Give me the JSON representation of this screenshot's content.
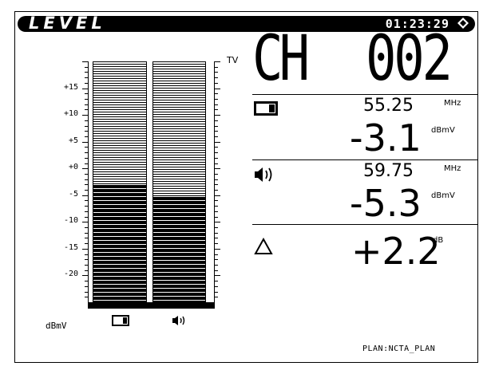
{
  "header": {
    "title": "LEVEL",
    "clock": "01:23:29"
  },
  "meter": {
    "y_labels": [
      "+15",
      "+10",
      "+5",
      "+0",
      "-5",
      "-10",
      "-15",
      "-20"
    ],
    "unit": "dBmV",
    "scale_min": -25,
    "scale_max": 20,
    "video_level": -3.1,
    "audio_level": -5.3
  },
  "channel": {
    "tv_label": "TV",
    "prefix": "CH",
    "number": "002"
  },
  "video": {
    "frequency": "55.25",
    "freq_unit": "MHz",
    "level": "-3.1",
    "level_unit": "dBmV"
  },
  "audio": {
    "frequency": "59.75",
    "freq_unit": "MHz",
    "level": "-5.3",
    "level_unit": "dBmV"
  },
  "delta": {
    "value": "+2.2",
    "unit": "dB"
  },
  "footer": {
    "plan": "PLAN:NCTA_PLAN"
  },
  "icons": {
    "video": "tv-screen-icon",
    "audio": "speaker-icon",
    "delta": "delta-icon",
    "gps": "gps-diamond-icon"
  }
}
